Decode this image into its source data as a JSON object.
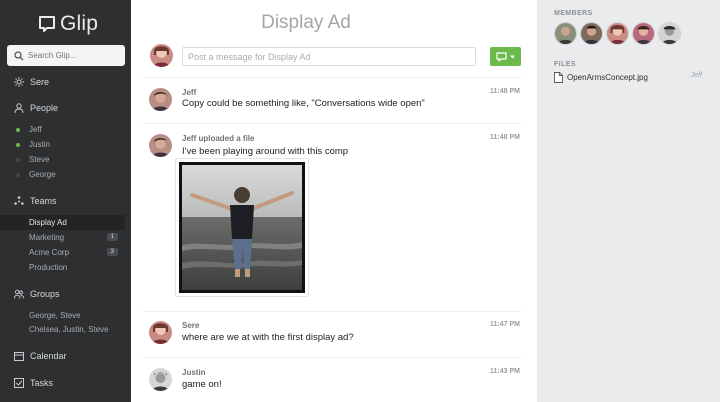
{
  "app": {
    "name": "Glip"
  },
  "sidebar": {
    "search_placeholder": "Search Glip...",
    "me": {
      "label": "Sere"
    },
    "people": {
      "label": "People",
      "items": [
        {
          "name": "Jeff",
          "online": true
        },
        {
          "name": "Justin",
          "online": true
        },
        {
          "name": "Steve",
          "online": false
        },
        {
          "name": "George",
          "online": false
        }
      ]
    },
    "teams": {
      "label": "Teams",
      "items": [
        {
          "name": "Display Ad",
          "count": ""
        },
        {
          "name": "Marketing",
          "count": "1"
        },
        {
          "name": "Acme Corp",
          "count": "3"
        },
        {
          "name": "Production",
          "count": ""
        }
      ]
    },
    "groups": {
      "label": "Groups",
      "items": [
        {
          "name": "George, Steve"
        },
        {
          "name": "Chelsea, Justin, Steve"
        }
      ]
    },
    "calendar": {
      "label": "Calendar"
    },
    "tasks": {
      "label": "Tasks"
    }
  },
  "main": {
    "title": "Display Ad",
    "composer_placeholder": "Post a message for Display Ad",
    "messages": [
      {
        "author": "Jeff",
        "time": "11:48 PM",
        "text": "Copy could be something like, \"Conversations wide open\""
      },
      {
        "author": "Jeff uploaded a file",
        "time": "11:48 PM",
        "text": "I've been playing around with this comp"
      },
      {
        "author": "Sere",
        "time": "11:47 PM",
        "text": "where are we at with the first display ad?"
      },
      {
        "author": "Justin",
        "time": "11:43 PM",
        "text": "game on!"
      }
    ]
  },
  "right_panel": {
    "members_label": "MEMBERS",
    "files_label": "FILES",
    "files": [
      {
        "name": "OpenArmsConcept.jpg",
        "owner": "Jeff"
      }
    ]
  },
  "colors": {
    "sidebar_bg": "#2d2f31",
    "accent_green": "#6cba4d",
    "right_panel_bg": "#e9ebed"
  }
}
